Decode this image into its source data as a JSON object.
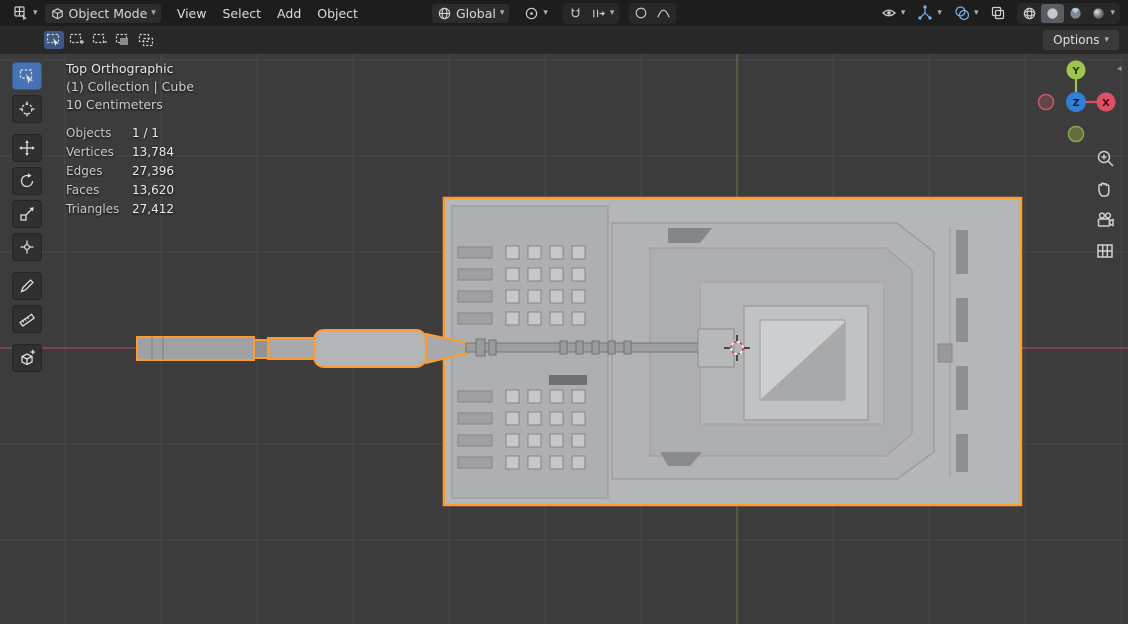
{
  "icons": {
    "chevron_down": "▾",
    "panel_toggle": "◂"
  },
  "header": {
    "mode": {
      "label": "Object Mode"
    },
    "menus": [
      {
        "label": "View"
      },
      {
        "label": "Select"
      },
      {
        "label": "Add"
      },
      {
        "label": "Object"
      }
    ],
    "transform": {
      "orientation_label": "Global"
    },
    "icon_names": [
      "editor-type-icon",
      "cube-icon",
      "globe-icon",
      "pivot-point-icon",
      "magnet-icon",
      "snap-target-icon",
      "proportional-circle-icon",
      "falloff-curve-icon",
      "visibility-eye-icon",
      "gizmo-icon",
      "overlays-icon",
      "xray-icon",
      "shading-wireframe-icon",
      "shading-solid-icon",
      "shading-material-icon",
      "shading-rendered-icon"
    ]
  },
  "tool_header": {
    "options_label": "Options",
    "select_mode_icons": [
      "select-new",
      "select-extend",
      "select-subtract",
      "select-invert",
      "select-intersect"
    ],
    "active_select_mode": "select-new"
  },
  "left_toolbar": {
    "active_tool": "select-box",
    "tool_icons": [
      "select-box-icon",
      "cursor-icon",
      "move-icon",
      "rotate-icon",
      "scale-icon",
      "transform-icon",
      "annotate-icon",
      "measure-icon",
      "add-cube-icon"
    ]
  },
  "viewport": {
    "overlay": {
      "view": "Top Orthographic",
      "context": "(1) Collection | Cube",
      "scale": "10 Centimeters",
      "stats": [
        {
          "label": "Objects",
          "value": "1 / 1"
        },
        {
          "label": "Vertices",
          "value": "13,784"
        },
        {
          "label": "Edges",
          "value": "27,396"
        },
        {
          "label": "Faces",
          "value": "13,620"
        },
        {
          "label": "Triangles",
          "value": "27,412"
        }
      ]
    },
    "nav_gizmo": {
      "y_label": "Y",
      "x_label": "X",
      "z_label": "Z"
    },
    "nav_icons": [
      "zoom-icon",
      "pan-hand-icon",
      "camera-view-icon",
      "grid-ortho-icon"
    ],
    "colors": {
      "background": "#3c3c3c",
      "grid": "#484848",
      "axis_x": "#a34a56",
      "axis_y": "#5f7346",
      "selection_outline": "#ff9b2e",
      "accent": "#4772b3"
    }
  }
}
